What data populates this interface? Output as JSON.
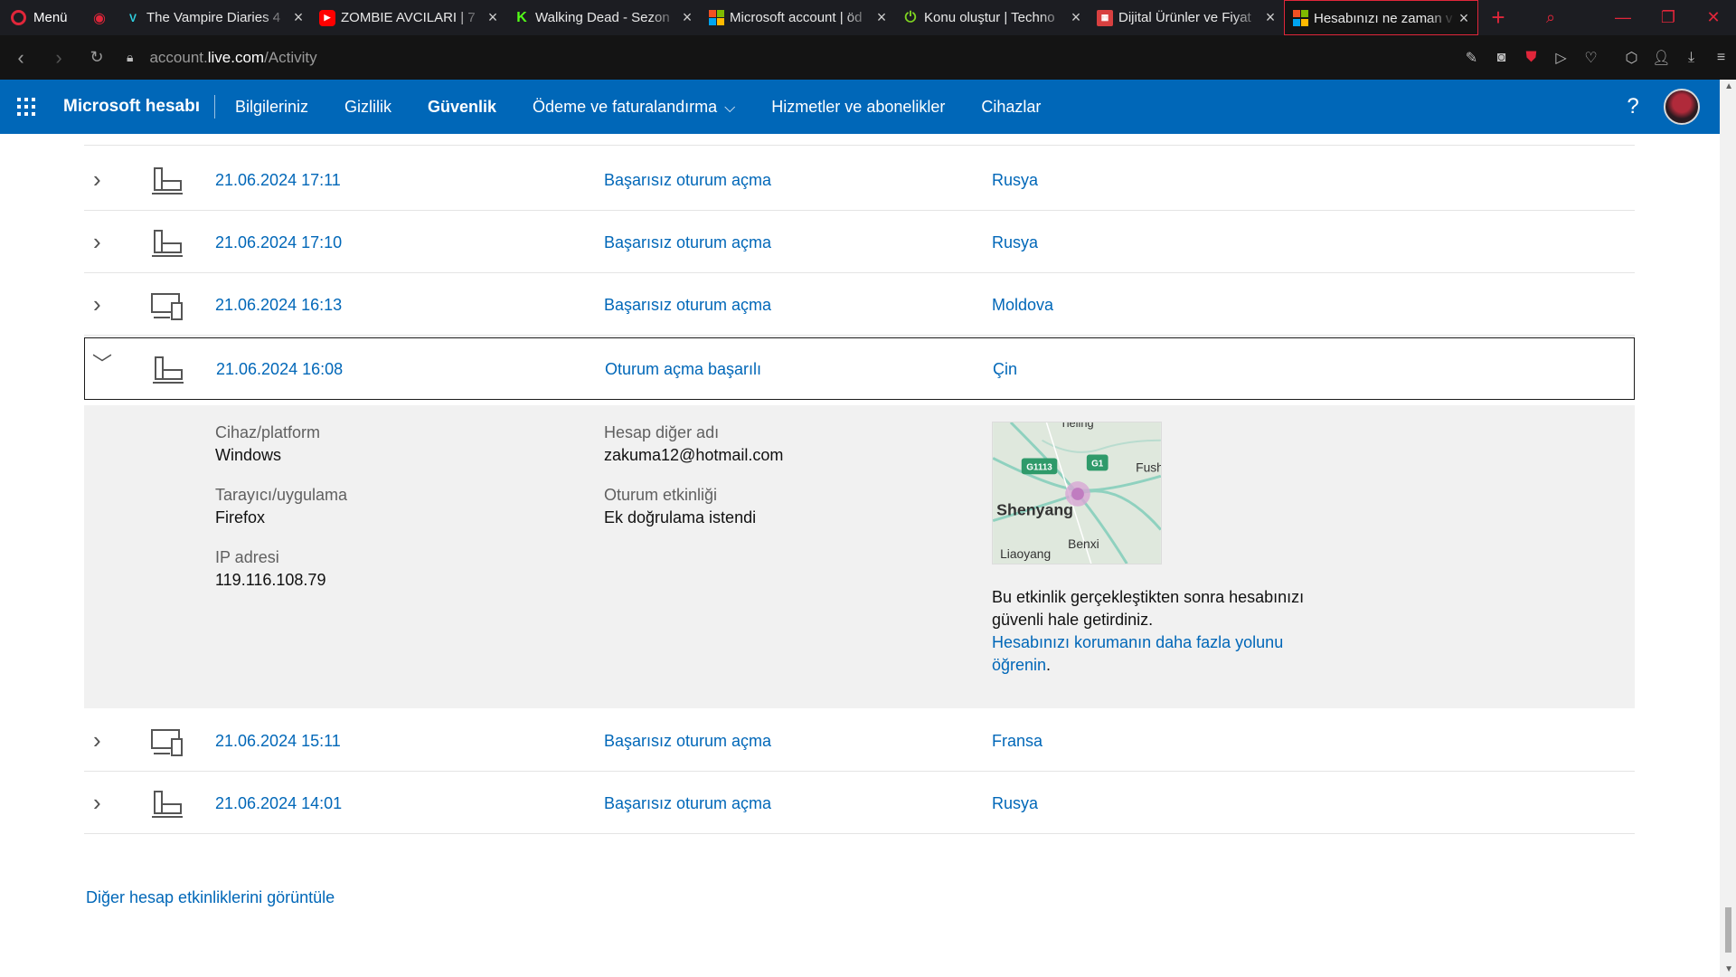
{
  "browser": {
    "menu_label": "Menü",
    "tabs": [
      {
        "title": "The Vampire Diaries 4"
      },
      {
        "title": "ZOMBIE AVCILARI | 7"
      },
      {
        "title": "Walking Dead - Sezon"
      },
      {
        "title": "Microsoft account | öd"
      },
      {
        "title": "Konu oluştur | Techno"
      },
      {
        "title": "Dijital Ürünler ve Fiyat"
      },
      {
        "title": "Hesabınızı ne zaman v"
      }
    ],
    "url_prefix": "account.",
    "url_domain": "live.com",
    "url_path": "/Activity"
  },
  "header": {
    "brand": "Microsoft hesabı",
    "nav": [
      {
        "label": "Bilgileriniz"
      },
      {
        "label": "Gizlilik"
      },
      {
        "label": "Güvenlik"
      },
      {
        "label": "Ödeme ve faturalandırma"
      },
      {
        "label": "Hizmetler ve abonelikler"
      },
      {
        "label": "Cihazlar"
      }
    ],
    "help_icon": "?"
  },
  "activity": {
    "rows": [
      {
        "date": "21.06.2024 17:11",
        "activity": "Başarısız oturum açma",
        "location": "Rusya",
        "device": "desktop-icon"
      },
      {
        "date": "21.06.2024 17:10",
        "activity": "Başarısız oturum açma",
        "location": "Rusya",
        "device": "desktop-icon"
      },
      {
        "date": "21.06.2024 16:13",
        "activity": "Başarısız oturum açma",
        "location": "Moldova",
        "device": "multi-device-icon"
      },
      {
        "date": "21.06.2024 16:08",
        "activity": "Oturum açma başarılı",
        "location": "Çin",
        "device": "desktop-icon"
      },
      {
        "date": "21.06.2024 15:11",
        "activity": "Başarısız oturum açma",
        "location": "Fransa",
        "device": "multi-device-icon"
      },
      {
        "date": "21.06.2024 14:01",
        "activity": "Başarısız oturum açma",
        "location": "Rusya",
        "device": "desktop-icon"
      }
    ],
    "details": {
      "platform_label": "Cihaz/platform",
      "platform_value": "Windows",
      "browser_label": "Tarayıcı/uygulama",
      "browser_value": "Firefox",
      "ip_label": "IP adresi",
      "ip_value": "119.116.108.79",
      "alias_label": "Hesap diğer adı",
      "alias_value": "zakuma12@hotmail.com",
      "session_label": "Oturum etkinliği",
      "session_value": "Ek doğrulama istendi",
      "map": {
        "city": "Shenyang",
        "labels": [
          "Tieling",
          "Fush",
          "Liaoyang",
          "Benxi"
        ],
        "shields": [
          "G1113",
          "G1"
        ]
      },
      "note_text": "Bu etkinlik gerçekleştikten sonra hesabınızı güvenli hale getirdiniz.",
      "note_link": "Hesabınızı korumanın daha fazla yolunu öğrenin",
      "note_period": "."
    },
    "more_link": "Diğer hesap etkinliklerini görüntüle"
  }
}
